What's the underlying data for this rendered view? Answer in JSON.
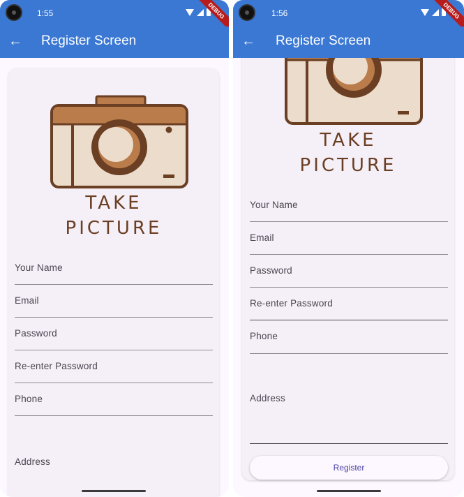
{
  "colors": {
    "appbar": "#3a78d4",
    "background": "#fdf7ff",
    "card": "#f5eff8",
    "camera_brown": "#6b3f23",
    "camera_light": "#ecdccb",
    "camera_accent": "#b97c4a",
    "button_text": "#4b43a4"
  },
  "screens": [
    {
      "status": {
        "time": "1:55",
        "debug_banner": "DEBUG"
      },
      "appbar": {
        "title": "Register Screen",
        "back_icon": "arrow-back-icon"
      },
      "logo": {
        "line1": "TAKE",
        "line2": "PICTURE",
        "icon": "camera-icon"
      },
      "fields": [
        {
          "label": "Your Name"
        },
        {
          "label": "Email"
        },
        {
          "label": "Password"
        },
        {
          "label": "Re-enter Password"
        },
        {
          "label": "Phone"
        },
        {
          "label": "Address"
        }
      ]
    },
    {
      "status": {
        "time": "1:56",
        "debug_banner": "DEBUG"
      },
      "appbar": {
        "title": "Register Screen",
        "back_icon": "arrow-back-icon"
      },
      "logo": {
        "line1": "TAKE",
        "line2": "PICTURE",
        "icon": "camera-icon"
      },
      "fields": [
        {
          "label": "Your Name"
        },
        {
          "label": "Email"
        },
        {
          "label": "Password"
        },
        {
          "label": "Re-enter Password"
        },
        {
          "label": "Phone"
        },
        {
          "label": "Address"
        }
      ],
      "register_button": "Register"
    }
  ]
}
